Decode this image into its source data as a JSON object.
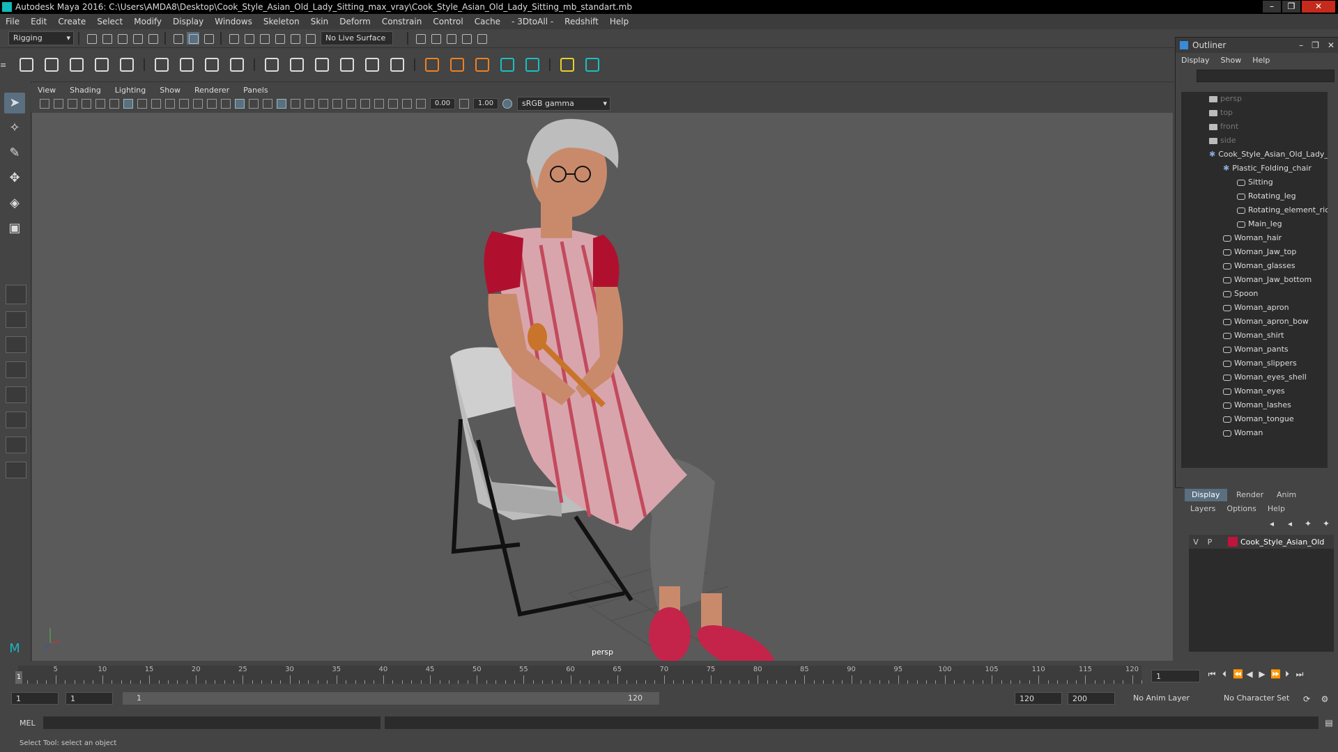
{
  "window": {
    "title": "Autodesk Maya 2016: C:\\Users\\AMDA8\\Desktop\\Cook_Style_Asian_Old_Lady_Sitting_max_vray\\Cook_Style_Asian_Old_Lady_Sitting_mb_standart.mb"
  },
  "menubar": [
    "File",
    "Edit",
    "Create",
    "Select",
    "Modify",
    "Display",
    "Windows",
    "Skeleton",
    "Skin",
    "Deform",
    "Constrain",
    "Control",
    "Cache",
    "- 3DtoAll -",
    "Redshift",
    "Help"
  ],
  "statusline": {
    "mode": "Rigging",
    "live_surface": "No Live Surface"
  },
  "panel_menu": [
    "View",
    "Shading",
    "Lighting",
    "Show",
    "Renderer",
    "Panels"
  ],
  "panel_tools": {
    "exposure": "0.00",
    "gamma": "1.00",
    "color_space": "sRGB gamma"
  },
  "viewport": {
    "camera": "persp"
  },
  "outliner": {
    "title": "Outliner",
    "menu": [
      "Display",
      "Show",
      "Help"
    ],
    "items": [
      {
        "label": "persp",
        "type": "camera",
        "depth": 2
      },
      {
        "label": "top",
        "type": "camera",
        "depth": 2
      },
      {
        "label": "front",
        "type": "camera",
        "depth": 2
      },
      {
        "label": "side",
        "type": "camera",
        "depth": 2
      },
      {
        "label": "Cook_Style_Asian_Old_Lady_",
        "type": "group",
        "depth": 2
      },
      {
        "label": "Plastic_Folding_chair",
        "type": "group",
        "depth": 3
      },
      {
        "label": "Sitting",
        "type": "mesh",
        "depth": 4
      },
      {
        "label": "Rotating_leg",
        "type": "mesh",
        "depth": 4
      },
      {
        "label": "Rotating_element_ric",
        "type": "mesh",
        "depth": 4
      },
      {
        "label": "Main_leg",
        "type": "mesh",
        "depth": 4
      },
      {
        "label": "Woman_hair",
        "type": "mesh",
        "depth": 3
      },
      {
        "label": "Woman_Jaw_top",
        "type": "mesh",
        "depth": 3
      },
      {
        "label": "Woman_glasses",
        "type": "mesh",
        "depth": 3
      },
      {
        "label": "Woman_Jaw_bottom",
        "type": "mesh",
        "depth": 3
      },
      {
        "label": "Spoon",
        "type": "mesh",
        "depth": 3
      },
      {
        "label": "Woman_apron",
        "type": "mesh",
        "depth": 3
      },
      {
        "label": "Woman_apron_bow",
        "type": "mesh",
        "depth": 3
      },
      {
        "label": "Woman_shirt",
        "type": "mesh",
        "depth": 3
      },
      {
        "label": "Woman_pants",
        "type": "mesh",
        "depth": 3
      },
      {
        "label": "Woman_slippers",
        "type": "mesh",
        "depth": 3
      },
      {
        "label": "Woman_eyes_shell",
        "type": "mesh",
        "depth": 3
      },
      {
        "label": "Woman_eyes",
        "type": "mesh",
        "depth": 3
      },
      {
        "label": "Woman_lashes",
        "type": "mesh",
        "depth": 3
      },
      {
        "label": "Woman_tongue",
        "type": "mesh",
        "depth": 3
      },
      {
        "label": "Woman",
        "type": "mesh",
        "depth": 3
      }
    ]
  },
  "layers": {
    "tabs": [
      "Display",
      "Render",
      "Anim"
    ],
    "menu": [
      "Layers",
      "Options",
      "Help"
    ],
    "row": {
      "v": "V",
      "p": "P",
      "name": "Cook_Style_Asian_Old",
      "color": "#c0143c"
    }
  },
  "timeline": {
    "ticks": [
      "5",
      "10",
      "15",
      "20",
      "25",
      "30",
      "35",
      "40",
      "45",
      "50",
      "55",
      "60",
      "65",
      "70",
      "75",
      "80",
      "85",
      "90",
      "95",
      "100",
      "105",
      "110",
      "115",
      "120"
    ],
    "current_marker": "1",
    "current_frame": "1"
  },
  "range": {
    "start": "1",
    "playback_start": "1",
    "slider_start": "1",
    "slider_end": "120",
    "playback_end": "120",
    "end": "200",
    "anim_layer": "No Anim Layer",
    "character_set": "No Character Set"
  },
  "cmdline": {
    "label": "MEL"
  },
  "helpline": {
    "text": "Select Tool: select an object"
  }
}
